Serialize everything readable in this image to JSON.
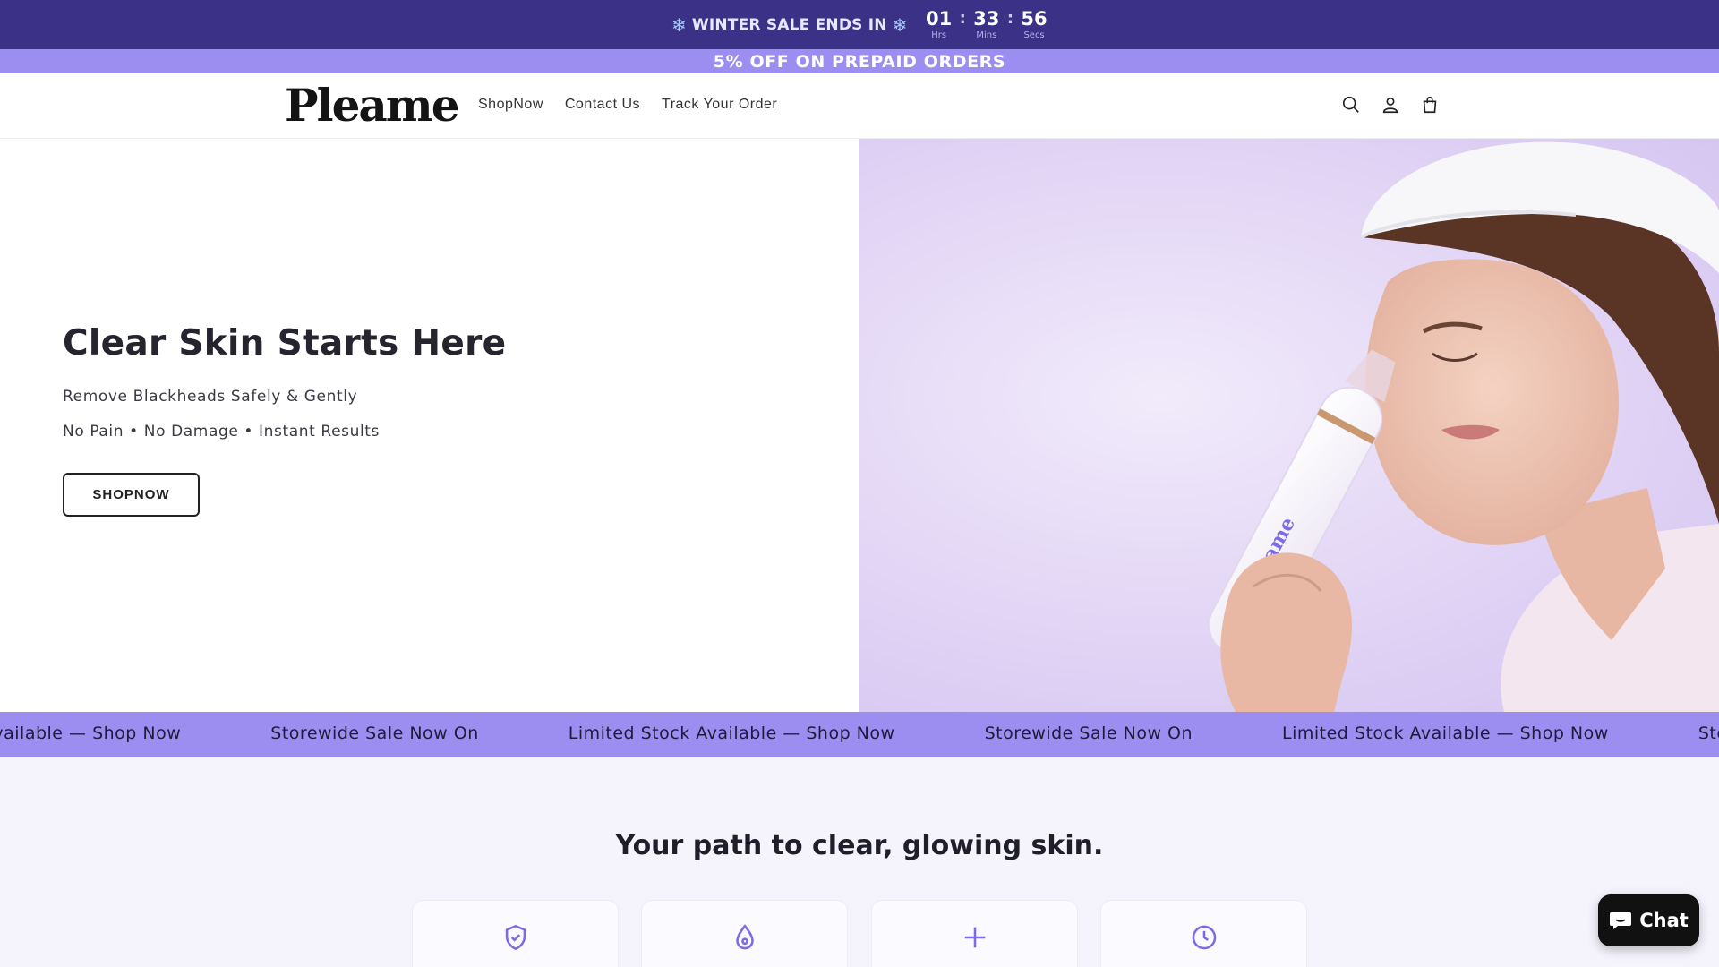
{
  "countdown": {
    "sale_text": "WINTER SALE ENDS IN",
    "hours": "01",
    "hours_label": "Hrs",
    "minutes": "33",
    "minutes_label": "Mins",
    "seconds": "56",
    "seconds_label": "Secs",
    "separator": ":"
  },
  "promo": {
    "prepaid": "5% OFF ON PREPAID ORDERS"
  },
  "header": {
    "logo": "Pleame",
    "nav": [
      "ShopNow",
      "Contact Us",
      "Track Your Order"
    ],
    "icons": [
      "search-icon",
      "account-icon",
      "cart-icon"
    ]
  },
  "hero": {
    "title": "Clear Skin Starts Here",
    "subtitle": "Remove Blackheads Safely & Gently",
    "features": "No Pain • No Damage • Instant Results",
    "button": "SHOPNOW",
    "device_brand": "Pleame"
  },
  "marquee": {
    "items": [
      "Available — Shop Now",
      "Storewide Sale Now On",
      "Limited Stock Available — Shop Now",
      "Storewide Sale Now On",
      "Limited Stock Available — Shop Now",
      "Storewide Sale Now On"
    ]
  },
  "path": {
    "title": "Your path to clear, glowing skin.",
    "card_icons": [
      "shield-check-icon",
      "droplet-icon",
      "plus-icon",
      "clock-icon"
    ]
  },
  "chat": {
    "label": "Chat"
  },
  "colors": {
    "accent": "#9c8df0",
    "dark_purple": "#3b3287",
    "icon_purple": "#7c6be6"
  }
}
